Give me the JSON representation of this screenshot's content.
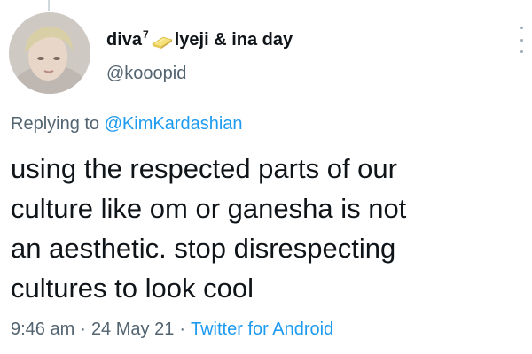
{
  "user": {
    "display_name_prefix": "diva",
    "display_name_sup": "7",
    "display_name_suffix": "lyeji & ina day",
    "handle": "@kooopid",
    "badge_icon": "butter-emoji-icon"
  },
  "reply": {
    "prefix": "Replying to",
    "mention": "@KimKardashian"
  },
  "body": {
    "lines": [
      "using the respected parts of our",
      "culture like om or ganesha is not",
      "an aesthetic. stop disrespecting",
      "cultures to look cool"
    ]
  },
  "meta": {
    "time": "9:46 am",
    "date": "24 May 21",
    "separator": "·",
    "source": "Twitter for Android"
  },
  "colors": {
    "text": "#0f1419",
    "secondary": "#536471",
    "link": "#1d9bf0"
  },
  "icons": {
    "menu": "more-options-icon"
  }
}
